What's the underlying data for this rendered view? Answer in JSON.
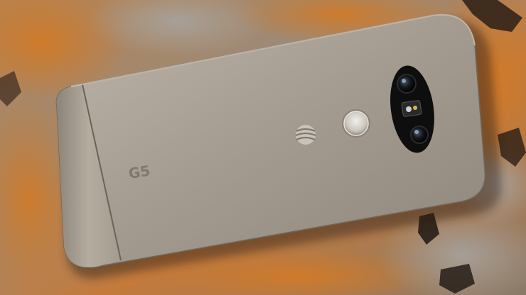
{
  "scene": {
    "subject": "smartphone-back",
    "surface": "slate-stone",
    "logo_text": "G5",
    "carrier_logo": "att-globe-icon",
    "colors": {
      "phone_body": "#a9a195",
      "phone_highlight": "#c9c2b6",
      "phone_shadow": "#7d756a",
      "stone_rust": "#c0702a",
      "stone_gray": "#8f8a84",
      "stone_dark": "#3a2a20",
      "camera_bar": "#141414"
    }
  }
}
